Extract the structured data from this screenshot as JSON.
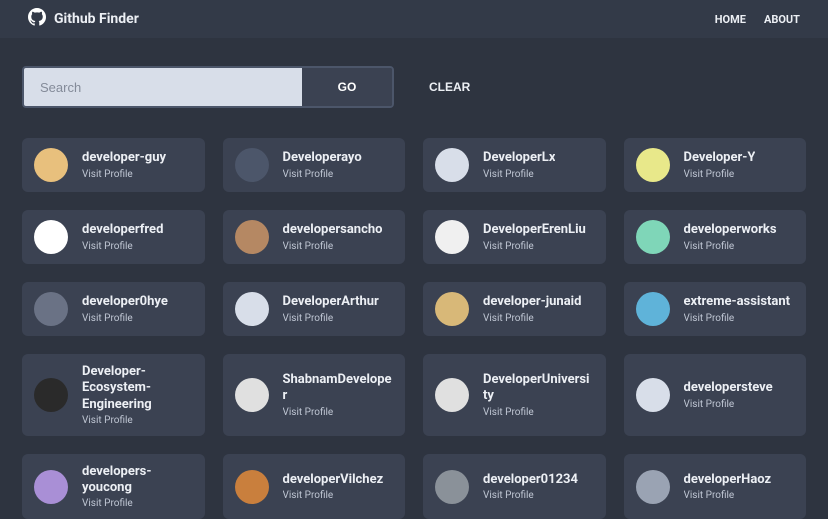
{
  "brand": "Github Finder",
  "nav": {
    "home": "HOME",
    "about": "ABOUT"
  },
  "search": {
    "placeholder": "Search",
    "go": "GO",
    "clear": "CLEAR"
  },
  "visit_label": "Visit Profile",
  "users": [
    {
      "login": "developer-guy",
      "color": "#e8c07d"
    },
    {
      "login": "Developerayo",
      "color": "#4c566a"
    },
    {
      "login": "DeveloperLx",
      "color": "#d8dee9"
    },
    {
      "login": "Developer-Y",
      "color": "#e8e88a"
    },
    {
      "login": "developerfred",
      "color": "#ffffff"
    },
    {
      "login": "developersancho",
      "color": "#b58863"
    },
    {
      "login": "DeveloperErenLiu",
      "color": "#f0f0f0"
    },
    {
      "login": "developerworks",
      "color": "#7fd6b8"
    },
    {
      "login": "developer0hye",
      "color": "#6a7285"
    },
    {
      "login": "DeveloperArthur",
      "color": "#d8dee9"
    },
    {
      "login": "developer-junaid",
      "color": "#d8b878"
    },
    {
      "login": "extreme-assistant",
      "color": "#5fb3d9"
    },
    {
      "login": "Developer-Ecosystem-Engineering",
      "color": "#2a2a2a"
    },
    {
      "login": "ShabnamDeveloper",
      "color": "#e0e0e0"
    },
    {
      "login": "DeveloperUniversity",
      "color": "#e0e0e0"
    },
    {
      "login": "developersteve",
      "color": "#d8dee9"
    },
    {
      "login": "developers-youcong",
      "color": "#a98fd6"
    },
    {
      "login": "developerVilchez",
      "color": "#c97f3d"
    },
    {
      "login": "developer01234",
      "color": "#8a9199"
    },
    {
      "login": "developerHaoz",
      "color": "#9aa3b3"
    }
  ]
}
